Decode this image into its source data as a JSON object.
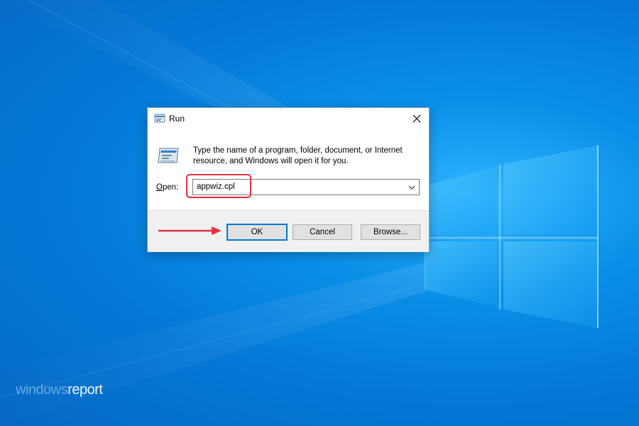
{
  "dialog": {
    "title": "Run",
    "description": "Type the name of a program, folder, document, or Internet resource, and Windows will open it for you.",
    "open_label_accel": "O",
    "open_label_rest": "pen:",
    "open_value": "appwiz.cpl",
    "buttons": {
      "ok": "OK",
      "cancel": "Cancel",
      "browse": "Browse..."
    }
  },
  "watermark": {
    "part1": "windows",
    "part2": "report"
  },
  "colors": {
    "highlight": "#e0323e",
    "ok_border": "#0078d7",
    "desktop": "#0478d8"
  },
  "icons": {
    "title": "run-app-icon",
    "close": "close-icon",
    "dropdown": "chevron-down-icon",
    "annotation": "red-arrow-right"
  }
}
